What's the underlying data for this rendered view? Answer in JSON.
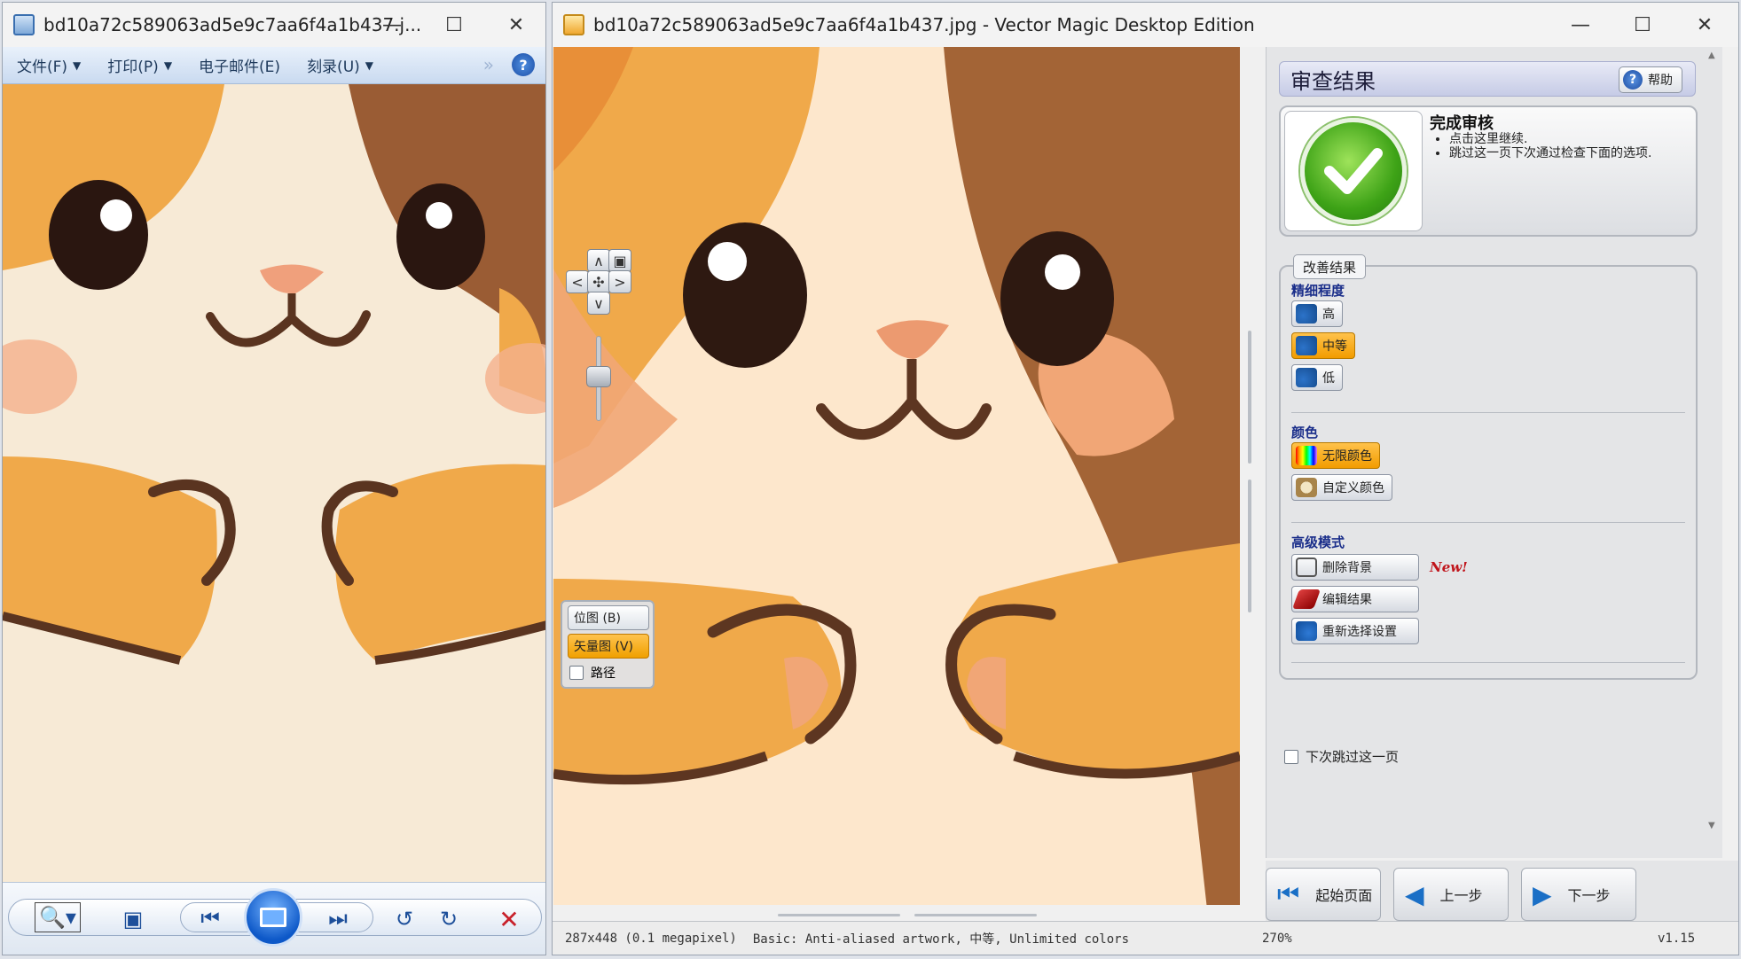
{
  "viewer": {
    "title": "bd10a72c589063ad5e9c7aa6f4a1b437.j...",
    "menu": [
      {
        "label": "文件(F)"
      },
      {
        "label": "打印(P)"
      },
      {
        "label": "电子邮件(E)"
      },
      {
        "label": "刻录(U)"
      }
    ]
  },
  "app": {
    "title": "bd10a72c589063ad5e9c7aa6f4a1b437.jpg - Vector Magic Desktop Edition",
    "view_buttons": {
      "bitmap": "位图 (B)",
      "vector": "矢量图 (V)",
      "paths": "路径"
    },
    "panel": {
      "header": "审查结果",
      "help": "帮助",
      "done_title": "完成审核",
      "done_items": [
        "点击这里继续.",
        "跳过这一页下次通过检查下面的选项."
      ],
      "improve_tab": "改善结果",
      "detail_label": "精细程度",
      "detail_high": "高",
      "detail_medium": "中等",
      "detail_low": "低",
      "color_label": "颜色",
      "color_unlimited": "无限颜色",
      "color_custom": "自定义颜色",
      "advanced_label": "高级模式",
      "remove_bg": "删除背景",
      "edit_result": "编辑结果",
      "reselect": "重新选择设置",
      "new_tag": "New!",
      "skip_label": "下次跳过这一页"
    },
    "nav": {
      "start": "起始页面",
      "prev": "上一步",
      "next": "下一步"
    },
    "status": {
      "size": "287x448 (0.1 megapixel)",
      "mode": "Basic: Anti-aliased artwork, 中等, Unlimited colors",
      "zoom": "270%",
      "version": "v1.15"
    }
  }
}
